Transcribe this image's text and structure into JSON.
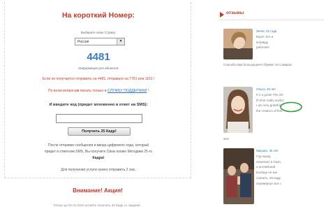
{
  "form": {
    "title": "На короткий Номер:",
    "country_label": "Выберите свою Страну:",
    "country_value": "Россия",
    "number": "4481",
    "number_caption": "Информация для абонента",
    "not_received_text": "Если не получается отправить на 4481, отправьте на 7781 или 1161 !",
    "support_text": "По всем вопросам писать только в",
    "support_link": "СЛУЖБУ ПОДДЕРЖКИ",
    "support_tail": "!",
    "enter_code_label": "И введите код (придет мгновенно в ответ на SMS):",
    "code_value": "",
    "submit_label": "Получить 25 Кадр!",
    "after_line1": "После отправки сообщения и ввода цифрового кода, который",
    "after_line2": "придет в ответном SMS, Вы получите Свою копию Методики 25-го",
    "after_line3": "Кадра!",
    "after_line4": "Для получения услуги нужно отправить 2 смс."
  },
  "promo": {
    "title": "Внимание! Акция!",
    "text": "Только до 01.01.2015 успейте получить 25 Кадр со скидкой..."
  },
  "reviews": {
    "header": "отзывы",
    "items": [
      {
        "who": "Женя, 22 года",
        "lines": [
          "Вау!!! Это и",
          "вправду",
          "работает."
        ]
      },
      {
        "who": "Ольга, 26 лет",
        "lines": [
          "It`s a great! The 25-",
          "th shot really works!",
          "I am very grateful",
          "the creators of this"
        ]
      },
      {
        "who": "Михаил, 45 лет",
        "lines": [
          "Год назад",
          "переехал в США,",
          "а английский",
          "вообще не мог",
          "освоить. 25 кадр",
          "перевернул все с"
        ]
      }
    ],
    "continuation_1": "Спасибо вам большущее!!! Привет из Самары!",
    "continuation_2": "site!"
  },
  "colors": {
    "accent_red": "#c0392b",
    "accent_blue": "#3a7cbf",
    "link_blue": "#2a74c5"
  }
}
